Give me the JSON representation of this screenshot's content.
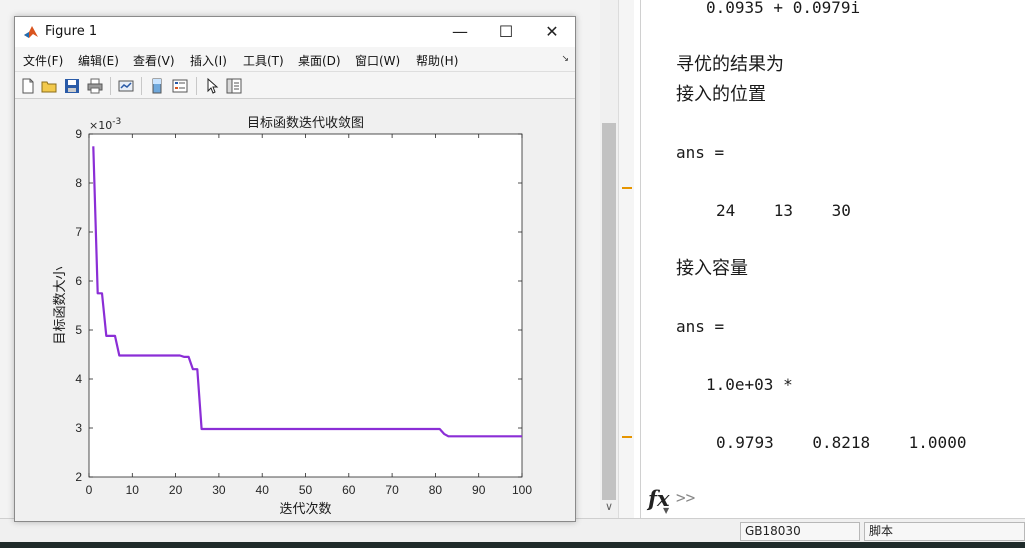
{
  "figure_window": {
    "title": "Figure 1",
    "menus": [
      "文件(F)",
      "编辑(E)",
      "查看(V)",
      "插入(I)",
      "工具(T)",
      "桌面(D)",
      "窗口(W)",
      "帮助(H)"
    ],
    "toolbar_icons": [
      "new-figure-icon",
      "open-file-icon",
      "save-icon",
      "print-icon",
      "link-plot-icon",
      "insert-colorbar-icon",
      "insert-legend-icon",
      "edit-plot-arrow-icon",
      "property-inspector-icon"
    ]
  },
  "chart_data": {
    "type": "line",
    "title": "目标函数迭代收敛图",
    "xlabel": "迭代次数",
    "ylabel": "目标函数大小",
    "exponent_label": "×10",
    "exponent_power": "-3",
    "xlim": [
      0,
      100
    ],
    "ylim": [
      2,
      9
    ],
    "xticks": [
      0,
      10,
      20,
      30,
      40,
      50,
      60,
      70,
      80,
      90,
      100
    ],
    "yticks": [
      2,
      3,
      4,
      5,
      6,
      7,
      8,
      9
    ],
    "line_color": "#8b2ed6",
    "grid": false,
    "series": [
      {
        "x": [
          1,
          2,
          3,
          4,
          5,
          6,
          7,
          8,
          20,
          21,
          22,
          23,
          24,
          25,
          26,
          27,
          80,
          81,
          82,
          83,
          100
        ],
        "y": [
          8.75,
          5.75,
          5.75,
          4.88,
          4.88,
          4.88,
          4.48,
          4.48,
          4.48,
          4.48,
          4.45,
          4.45,
          4.2,
          4.2,
          2.98,
          2.98,
          2.98,
          2.98,
          2.88,
          2.83,
          2.83
        ]
      }
    ]
  },
  "command_window": {
    "lines": [
      {
        "text": "0.0935 + 0.0979i",
        "cjk": false
      },
      {
        "text": "寻优的结果为",
        "cjk": true
      },
      {
        "text": "接入的位置",
        "cjk": true
      },
      {
        "text": "ans =",
        "cjk": false
      },
      {
        "text": "24    13    30",
        "cjk": false
      },
      {
        "text": "接入容量",
        "cjk": true
      },
      {
        "text": "ans =",
        "cjk": false
      },
      {
        "text": "1.0e+03 *",
        "cjk": false
      },
      {
        "text": "0.9793    0.8218    1.0000",
        "cjk": false
      }
    ],
    "prompt": ">>"
  },
  "status_bar": {
    "encoding": "GB18030",
    "mode": "脚本"
  },
  "colors": {
    "accent_marker": "#e69500",
    "plot_line": "#8b2ed6"
  }
}
